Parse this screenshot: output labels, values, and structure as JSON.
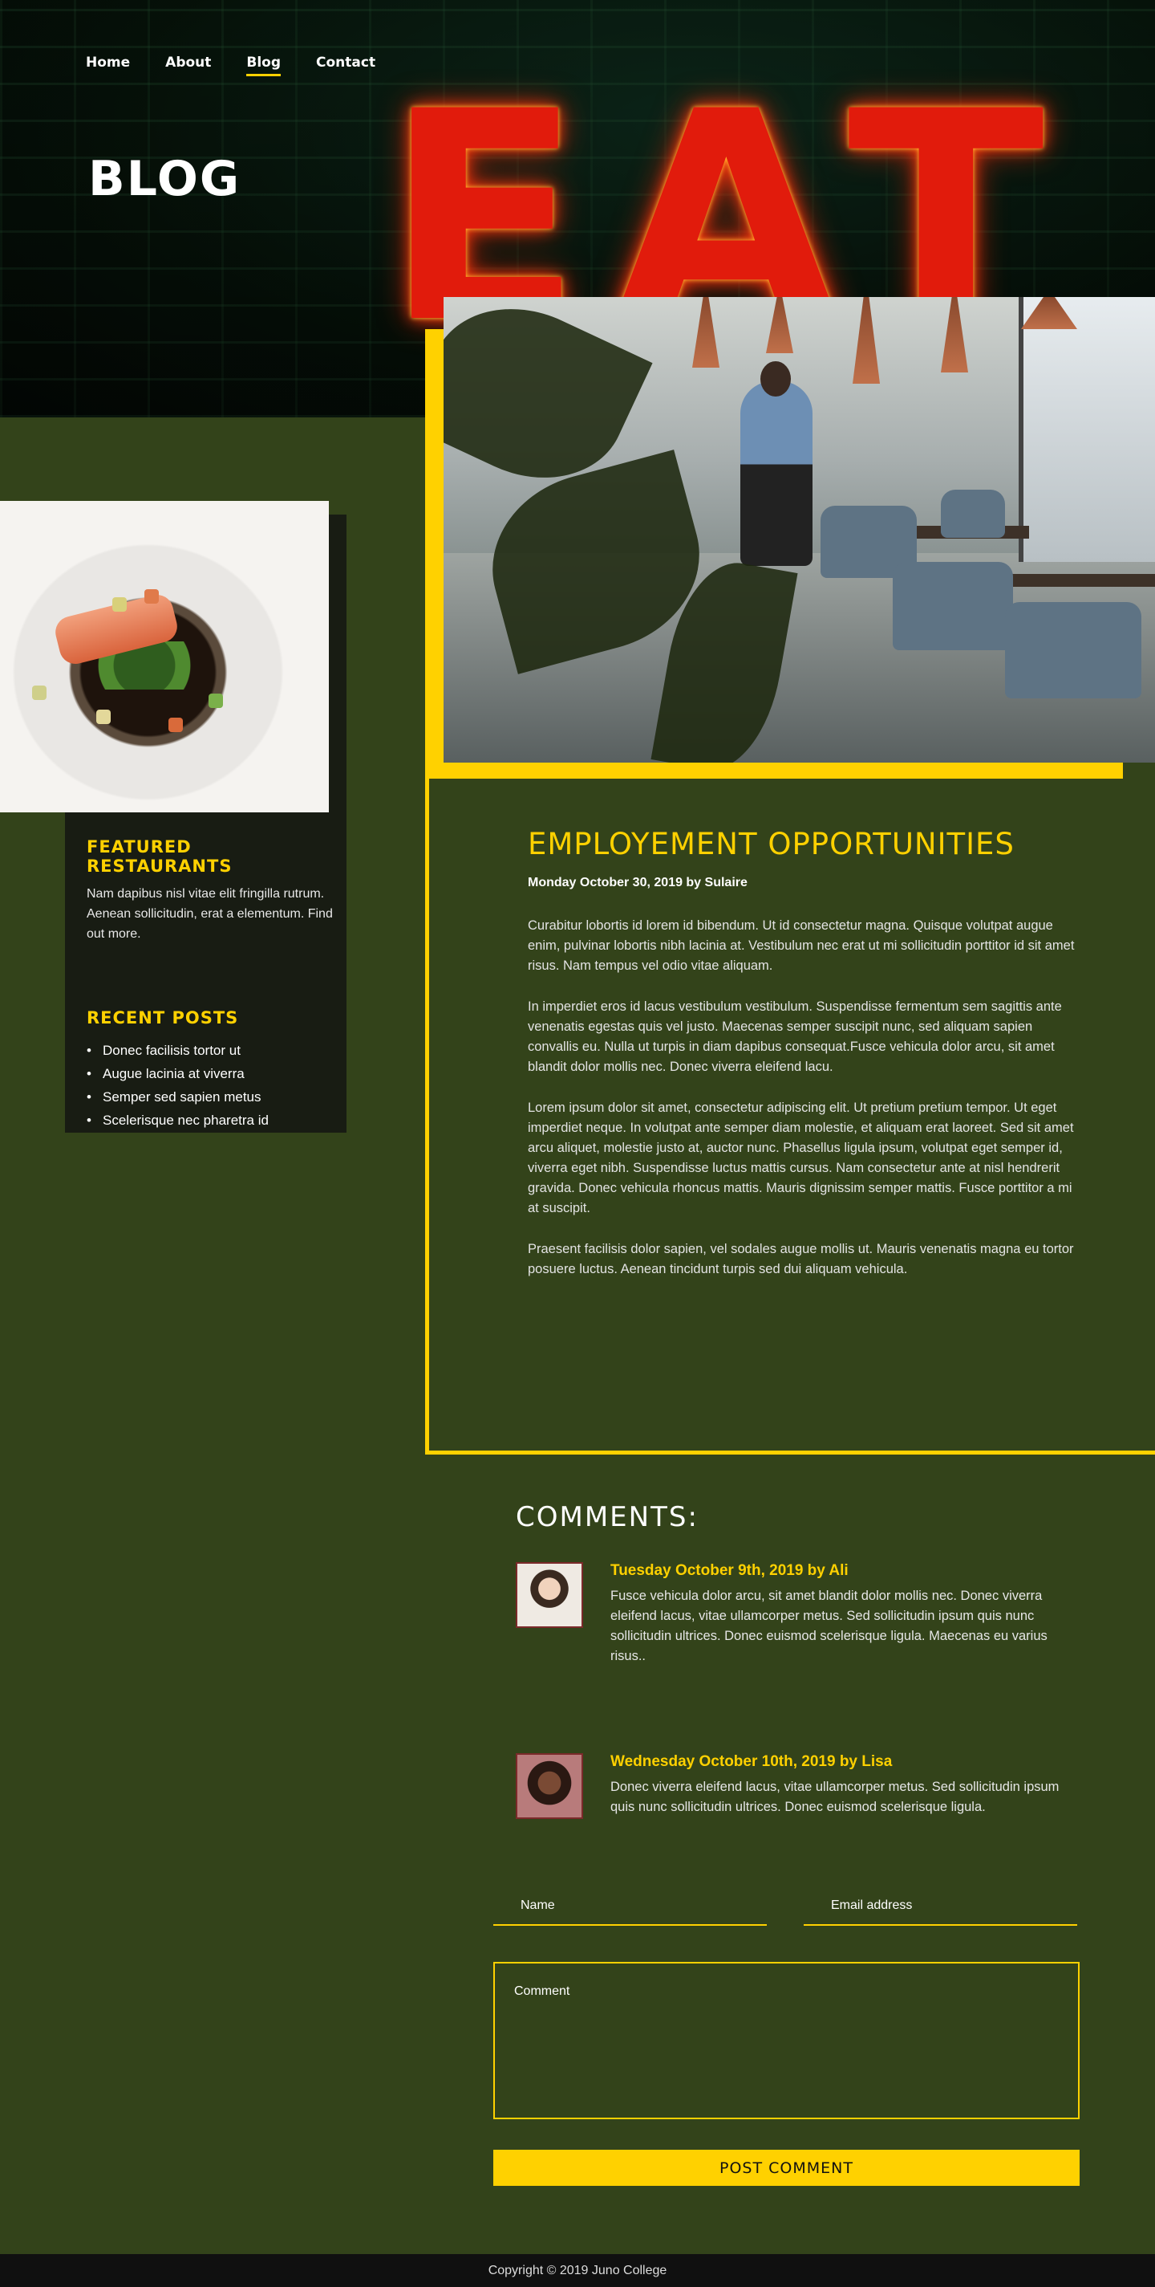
{
  "nav": {
    "items": [
      {
        "label": "Home",
        "active": false
      },
      {
        "label": "About",
        "active": false
      },
      {
        "label": "Blog",
        "active": true
      },
      {
        "label": "Contact",
        "active": false
      }
    ]
  },
  "hero": {
    "title": "BLOG",
    "neon_sign": "EAT"
  },
  "sidebar": {
    "featured_heading": "FEATURED RESTAURANTS",
    "featured_text": "Nam dapibus nisl vitae elit fringilla rutrum. Aenean sollicitudin, erat a elementum. Find out more.",
    "recent_heading": "RECENT POSTS",
    "recent_posts": [
      "Donec facilisis tortor ut",
      "Augue lacinia at viverra",
      "Semper sed sapien metus",
      "Scelerisque nec pharetra id"
    ]
  },
  "article": {
    "title": "EMPLOYEMENT OPPORTUNITIES",
    "meta": "Monday October 30, 2019 by Sulaire",
    "paragraphs": [
      "Curabitur lobortis id lorem id bibendum. Ut id consectetur magna. Quisque volutpat augue enim, pulvinar lobortis nibh lacinia at. Vestibulum nec erat ut mi sollicitudin porttitor id sit amet risus. Nam tempus vel odio vitae aliquam.",
      "In imperdiet eros id lacus vestibulum vestibulum. Suspendisse fermentum sem sagittis ante venenatis egestas quis vel justo. Maecenas semper suscipit nunc, sed aliquam sapien convallis eu. Nulla ut turpis in diam dapibus consequat.Fusce vehicula dolor arcu, sit amet blandit dolor mollis nec. Donec viverra eleifend lacu.",
      "Lorem ipsum dolor sit amet, consectetur adipiscing elit. Ut pretium pretium tempor. Ut eget imperdiet neque. In volutpat ante semper diam molestie, et aliquam erat laoreet. Sed sit amet arcu aliquet, molestie justo at, auctor nunc. Phasellus ligula ipsum, volutpat eget semper id, viverra eget nibh. Suspendisse luctus mattis cursus. Nam consectetur ante at nisl hendrerit gravida. Donec vehicula rhoncus mattis. Mauris dignissim semper mattis. Fusce porttitor a mi at suscipit.",
      "Praesent facilisis dolor sapien, vel sodales augue mollis ut. Mauris venenatis magna eu tortor posuere luctus. Aenean tincidunt turpis sed dui aliquam vehicula."
    ]
  },
  "comments": {
    "heading": "COMMENTS:",
    "items": [
      {
        "meta": "Tuesday October 9th, 2019 by Ali",
        "text": "Fusce vehicula dolor arcu, sit amet blandit dolor mollis nec. Donec viverra eleifend lacus, vitae ullamcorper metus. Sed sollicitudin ipsum quis nunc sollicitudin ultrices. Donec euismod scelerisque ligula. Maecenas eu varius risus.."
      },
      {
        "meta": "Wednesday October 10th, 2019 by Lisa",
        "text": "Donec viverra eleifend lacus, vitae ullamcorper metus. Sed sollicitudin ipsum quis nunc sollicitudin ultrices. Donec euismod scelerisque ligula."
      }
    ]
  },
  "form": {
    "name_placeholder": "Name",
    "email_placeholder": "Email address",
    "comment_placeholder": "Comment",
    "submit_label": "POST COMMENT"
  },
  "footer": {
    "copyright": "Copyright © 2019 Juno College"
  },
  "colors": {
    "accent": "#ffd100",
    "background": "#33431a",
    "sidebar_card": "#181c13",
    "footer": "#101010"
  }
}
